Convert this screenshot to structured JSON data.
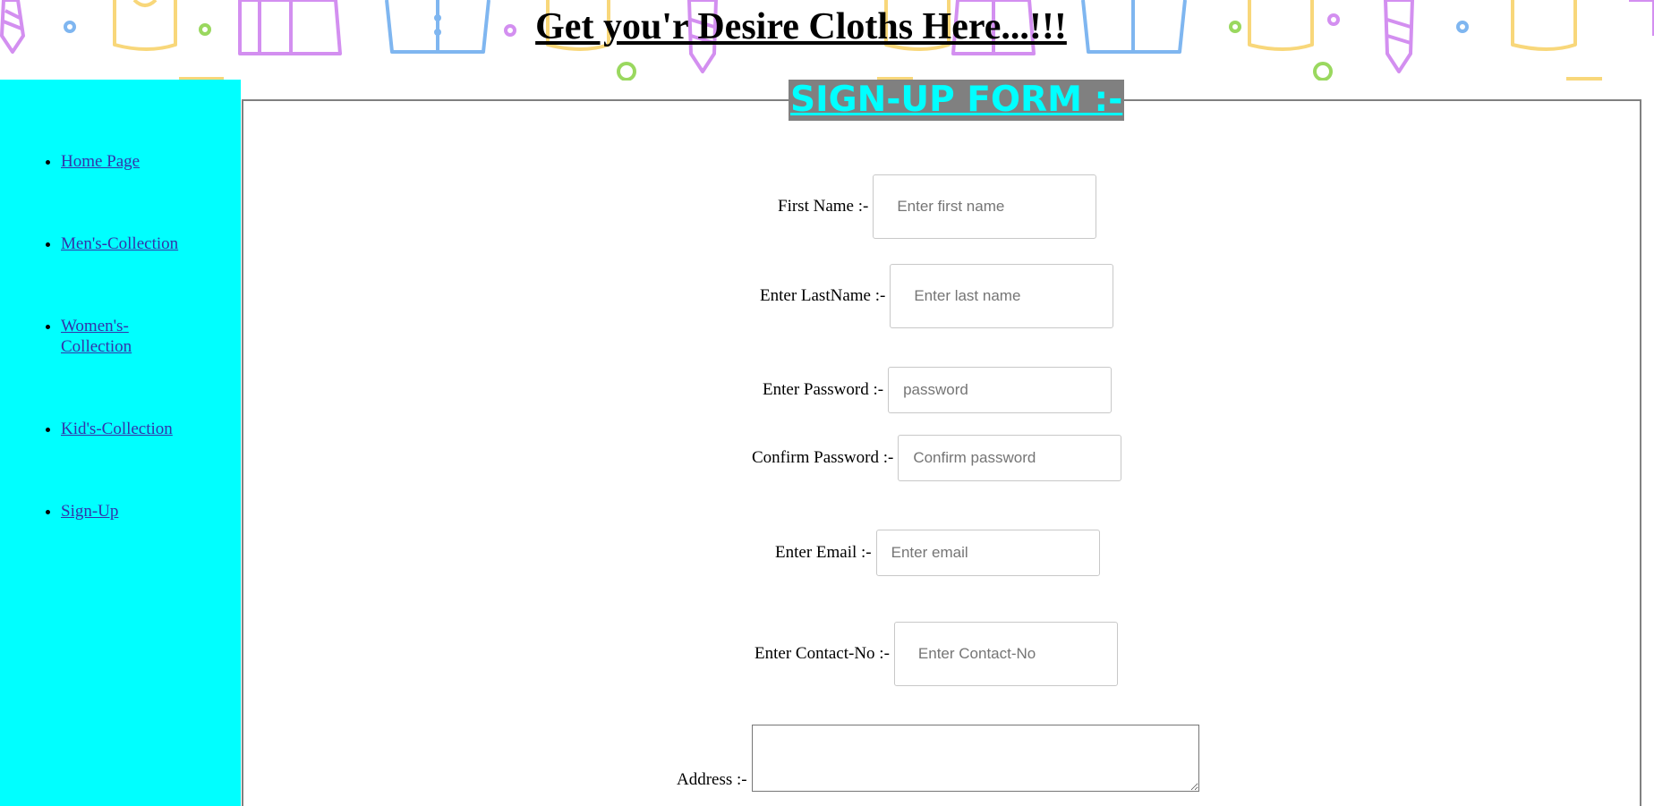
{
  "header": {
    "title": "Get you'r Desire Cloths Here...!!!"
  },
  "sidebar": {
    "items": [
      {
        "label": "Home Page"
      },
      {
        "label": "Men's-Collection"
      },
      {
        "label": "Women's-Collection"
      },
      {
        "label": "Kid's-Collection"
      },
      {
        "label": "Sign-Up"
      }
    ]
  },
  "form": {
    "title": "SIGN-UP FORM :-",
    "first_name": {
      "label": "First Name :-",
      "placeholder": "Enter first name",
      "value": ""
    },
    "last_name": {
      "label": "Enter LastName :-",
      "placeholder": "Enter last name",
      "value": ""
    },
    "password": {
      "label": "Enter Password :-",
      "placeholder": "password",
      "value": ""
    },
    "confirm_password": {
      "label": "Confirm Password :-",
      "placeholder": "Confirm password",
      "value": ""
    },
    "email": {
      "label": "Enter Email :-",
      "placeholder": "Enter email",
      "value": ""
    },
    "contact": {
      "label": "Enter Contact-No :-",
      "placeholder": "Enter Contact-No",
      "value": ""
    },
    "address": {
      "label": "Address :-",
      "value": ""
    }
  },
  "colors": {
    "sidebar_bg": "#00ffff",
    "form_title_bg": "#808080",
    "form_title_text": "#00ffff",
    "panel_border": "#808080"
  }
}
